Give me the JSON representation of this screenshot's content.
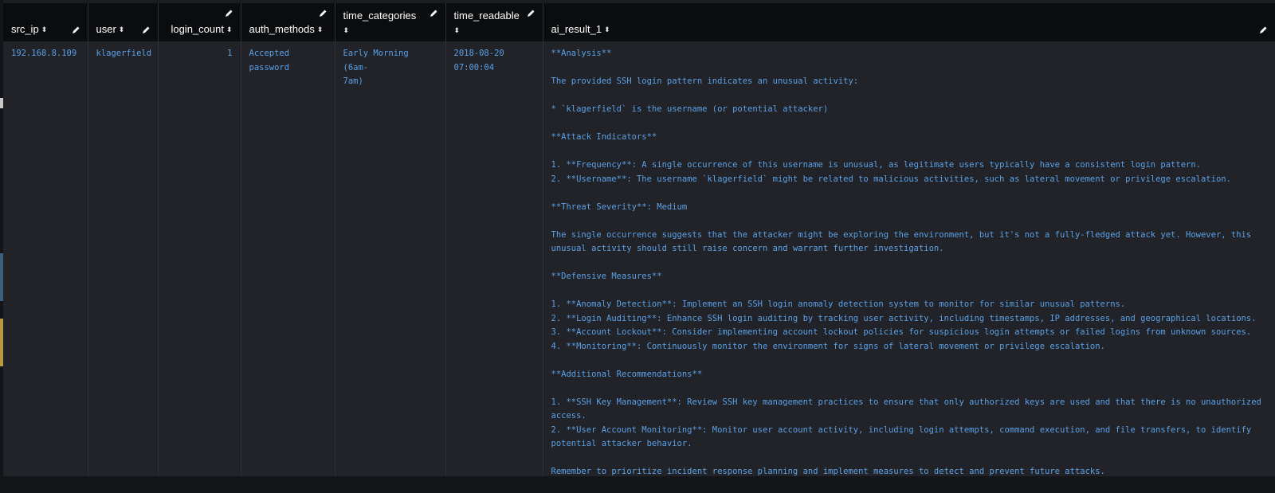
{
  "columns": {
    "src_ip": "src_ip",
    "user": "user",
    "login_count": "login_count",
    "auth_methods": "auth_methods",
    "time_categories": "time_categories",
    "time_readable": "time_readable",
    "ai_result_1": "ai_result_1"
  },
  "row": {
    "src_ip": "192.168.8.109",
    "user": "klagerfield",
    "login_count": "1",
    "auth_methods_line1": "Accepted",
    "auth_methods_line2": "password",
    "time_categories_line1": "Early Morning (6am-",
    "time_categories_line2": "7am)",
    "time_readable_line1": "2018-08-20",
    "time_readable_line2": "07:00:04",
    "ai_result_1": [
      "**Analysis**",
      "",
      "The provided SSH login pattern indicates an unusual activity:",
      "",
      "* `klagerfield` is the username (or potential attacker)",
      "",
      "**Attack Indicators**",
      "",
      "1. **Frequency**: A single occurrence of this username is unusual, as legitimate users typically have a consistent login pattern.",
      "2. **Username**: The username `klagerfield` might be related to malicious activities, such as lateral movement or privilege escalation.",
      "",
      "**Threat Severity**: Medium",
      "",
      "The single occurrence suggests that the attacker might be exploring the environment, but it's not a fully-fledged attack yet. However, this",
      "unusual activity should still raise concern and warrant further investigation.",
      "",
      "**Defensive Measures**",
      "",
      "1. **Anomaly Detection**: Implement an SSH login anomaly detection system to monitor for similar unusual patterns.",
      "2. **Login Auditing**: Enhance SSH login auditing by tracking user activity, including timestamps, IP addresses, and geographical locations.",
      "3. **Account Lockout**: Consider implementing account lockout policies for suspicious login attempts or failed logins from unknown sources.",
      "4. **Monitoring**: Continuously monitor the environment for signs of lateral movement or privilege escalation.",
      "",
      "**Additional Recommendations**",
      "",
      "1. **SSH Key Management**: Review SSH key management practices to ensure that only authorized keys are used and that there is no unauthorized",
      "access.",
      "2. **User Account Monitoring**: Monitor user account activity, including login attempts, command execution, and file transfers, to identify",
      "potential attacker behavior.",
      "",
      "Remember to prioritize incident response planning and implement measures to detect and prevent future attacks."
    ]
  },
  "colors": {
    "header_bg": "#0b0c0e",
    "body_bg": "#212328",
    "cell_text": "#5aa0e6",
    "header_text": "#ffffff"
  },
  "icons": {
    "sort": "sort-icon",
    "edit": "pencil-icon"
  }
}
